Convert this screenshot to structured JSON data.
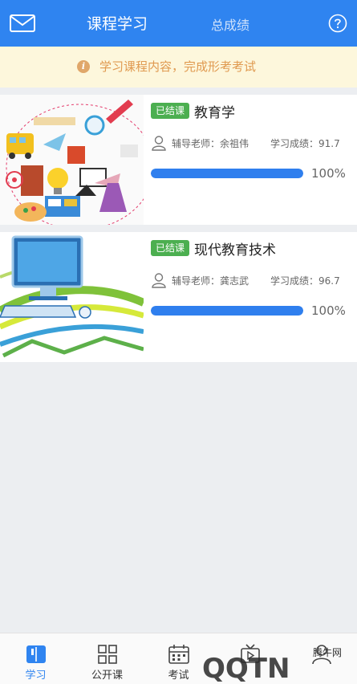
{
  "header": {
    "tab_active": "课程学习",
    "tab_other": "总成绩",
    "accent": "#2f84f0"
  },
  "notice": {
    "text": "学习课程内容，完成形考考试",
    "icon": "info-icon"
  },
  "courses": [
    {
      "badge": "已结课",
      "title": "教育学",
      "teacher": "辅导老师：余祖伟",
      "score": "学习成绩：91.7",
      "progress": 1.0,
      "progress_text": "100%"
    },
    {
      "badge": "已结课",
      "title": "现代教育技术",
      "teacher": "辅导老师：龚志武",
      "score": "学习成绩：96.7",
      "progress": 1.0,
      "progress_text": "100%"
    }
  ],
  "tabbar": {
    "items": [
      {
        "label": "学习",
        "icon": "book-icon"
      },
      {
        "label": "公开课",
        "icon": "grid-icon"
      },
      {
        "label": "考试",
        "icon": "calendar-icon"
      },
      {
        "label": "",
        "icon": "tv-icon"
      },
      {
        "label": "",
        "icon": "user-icon"
      }
    ]
  },
  "watermark": {
    "text": "QQTN",
    "sub": "腾牛网"
  }
}
